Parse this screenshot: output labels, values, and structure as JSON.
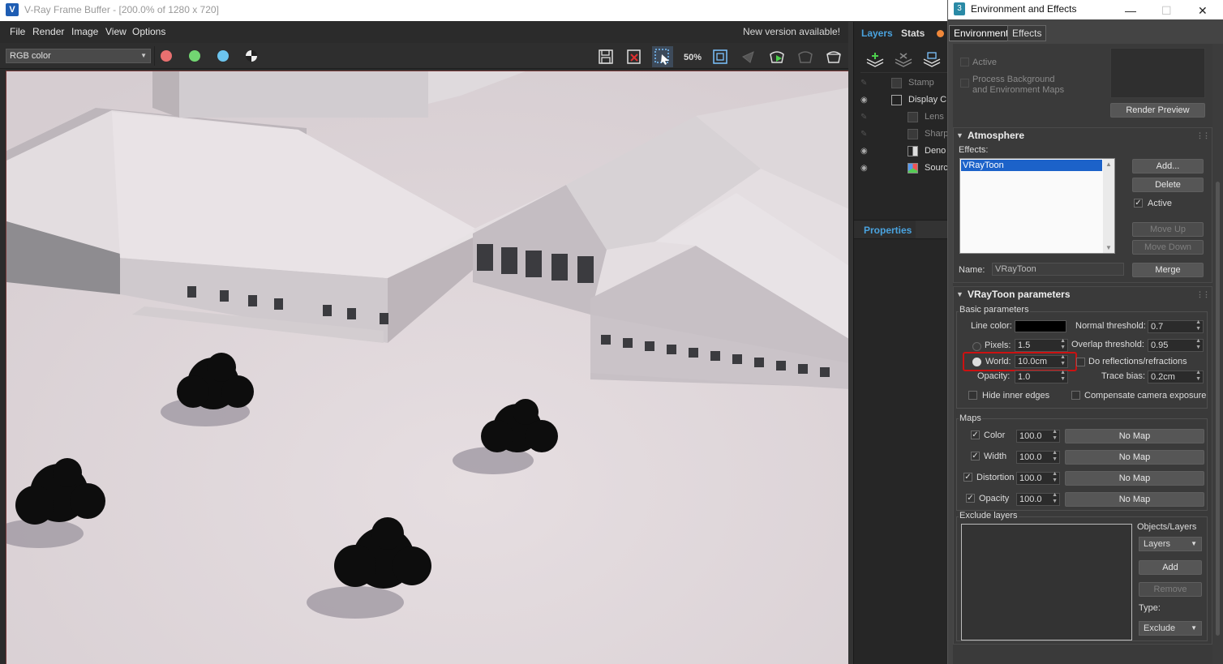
{
  "vfb": {
    "title": "V-Ray Frame Buffer - [200.0% of 1280 x 720]",
    "menu": [
      "File",
      "Render",
      "Image",
      "View",
      "Options"
    ],
    "new_version": "New version available!",
    "channel": "RGB color",
    "zoom_icon_text": "50%",
    "side_tabs": [
      "Layers",
      "Stats"
    ],
    "layers": [
      {
        "label": "Stamp",
        "visible": false
      },
      {
        "label": "Display C",
        "visible": true
      },
      {
        "label": "Lens",
        "visible": false
      },
      {
        "label": "Sharp",
        "visible": false
      },
      {
        "label": "Deno",
        "visible": true
      },
      {
        "label": "Sourc",
        "visible": true
      }
    ],
    "properties_label": "Properties"
  },
  "env": {
    "title": "Environment and Effects",
    "tabs": [
      "Environment",
      "Effects"
    ],
    "preview": {
      "active_label": "Active",
      "process_bg_label": "Process Background\nand Environment Maps",
      "render_preview": "Render Preview"
    },
    "atmosphere": {
      "header": "Atmosphere",
      "effects_label": "Effects:",
      "effects_list": [
        "VRayToon"
      ],
      "add": "Add...",
      "delete": "Delete",
      "active": "Active",
      "move_up": "Move Up",
      "move_down": "Move Down",
      "name_label": "Name:",
      "name_value": "VRayToon",
      "merge": "Merge"
    },
    "vraytoon": {
      "header": "VRayToon parameters",
      "basic": "Basic parameters",
      "line_color_label": "Line color:",
      "line_color": "#000000",
      "normal_threshold_label": "Normal threshold:",
      "normal_threshold": "0.7",
      "pixels_label": "Pixels:",
      "pixels": "1.5",
      "overlap_threshold_label": "Overlap threshold:",
      "overlap_threshold": "0.95",
      "world_label": "World:",
      "world": "10.0cm",
      "do_reflections_label": "Do reflections/refractions",
      "opacity_label": "Opacity:",
      "opacity": "1.0",
      "trace_bias_label": "Trace bias:",
      "trace_bias": "0.2cm",
      "hide_inner_label": "Hide inner edges",
      "compensate_label": "Compensate camera exposure",
      "maps_label": "Maps",
      "maps": [
        {
          "label": "Color",
          "value": "100.0",
          "map": "No Map"
        },
        {
          "label": "Width",
          "value": "100.0",
          "map": "No Map"
        },
        {
          "label": "Distortion",
          "value": "100.0",
          "map": "No Map"
        },
        {
          "label": "Opacity",
          "value": "100.0",
          "map": "No Map"
        }
      ],
      "exclude_label": "Exclude layers",
      "objects_layers_label": "Objects/Layers",
      "objects_layers_value": "Layers",
      "add": "Add",
      "remove": "Remove",
      "type_label": "Type:",
      "type_value": "Exclude"
    }
  },
  "colors": {
    "accent_blue": "#4aa3df",
    "highlight_red": "#cc1111",
    "selection": "#1c62c9"
  }
}
